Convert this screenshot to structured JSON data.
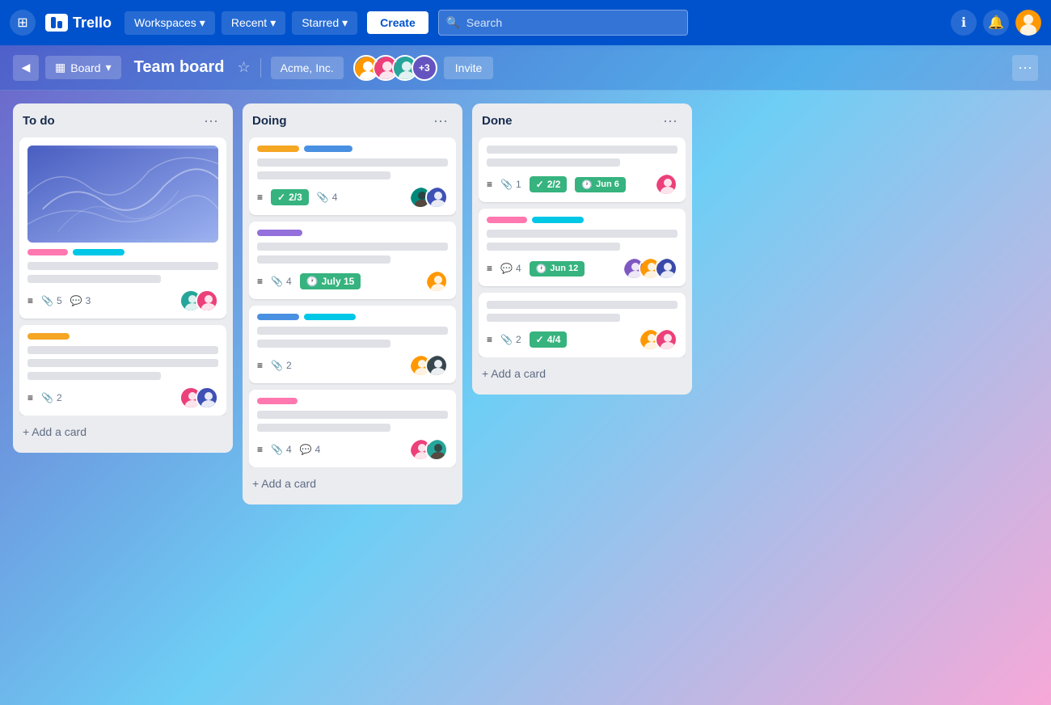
{
  "topnav": {
    "logo_text": "Trello",
    "workspaces_label": "Workspaces",
    "recent_label": "Recent",
    "starred_label": "Starred",
    "create_label": "Create",
    "search_placeholder": "Search",
    "chevron": "▾"
  },
  "subheader": {
    "board_label": "Board",
    "board_title": "Team board",
    "workspace_label": "Acme, Inc.",
    "members_extra": "+3",
    "invite_label": "Invite"
  },
  "columns": {
    "todo": {
      "title": "To do",
      "add_card": "+ Add a card",
      "cards": [
        {
          "has_image": true,
          "tags": [
            "pink",
            "cyan"
          ],
          "lines": [
            "full",
            "partial"
          ],
          "meta_desc": true,
          "attachments": "5",
          "comments": "3",
          "avatars": [
            "teal",
            "pink"
          ]
        },
        {
          "has_image": false,
          "tags": [
            "yellow"
          ],
          "lines": [
            "full",
            "full",
            "partial"
          ],
          "meta_desc": false,
          "attachments": "2",
          "comments": null,
          "avatars": [
            "pink",
            "blue"
          ]
        }
      ]
    },
    "doing": {
      "title": "Doing",
      "add_card": "+ Add a card",
      "cards": [
        {
          "tags": [
            "yellow",
            "blue"
          ],
          "lines": [
            "full",
            "partial"
          ],
          "meta_desc": true,
          "attachments": null,
          "checklist": "2/3",
          "attach_count": "4",
          "avatars": [
            "dark-teal",
            "blue"
          ]
        },
        {
          "tags": [
            "purple"
          ],
          "lines": [
            "full",
            "partial"
          ],
          "meta_desc": true,
          "attachments": "4",
          "date": "July 15",
          "avatars": [
            "orange"
          ]
        },
        {
          "tags": [
            "blue",
            "cyan"
          ],
          "lines": [
            "full",
            "partial"
          ],
          "meta_desc": true,
          "attachments": "2",
          "avatars": [
            "orange",
            "dark-blue"
          ]
        },
        {
          "tags": [
            "pink"
          ],
          "lines": [
            "full",
            "partial"
          ],
          "meta_desc": true,
          "attachments": "4",
          "comments": "4",
          "avatars": [
            "pink",
            "dark-teal2"
          ]
        }
      ]
    },
    "done": {
      "title": "Done",
      "add_card": "+ Add a card",
      "cards": [
        {
          "tags": [],
          "lines": [
            "full",
            "partial"
          ],
          "meta_desc": true,
          "attachments": "1",
          "checklist": "2/2",
          "date": "Jun 6",
          "avatars": [
            "pink"
          ]
        },
        {
          "tags": [
            "pink",
            "cyan"
          ],
          "lines": [
            "full",
            "partial"
          ],
          "meta_desc": true,
          "comments": "4",
          "date": "Jun 12",
          "avatars": [
            "purple",
            "amber",
            "indigo"
          ]
        },
        {
          "tags": [],
          "lines": [
            "full",
            "partial"
          ],
          "meta_desc": true,
          "attachments": "2",
          "checklist": "4/4",
          "avatars": [
            "amber",
            "pink2"
          ]
        }
      ]
    }
  }
}
